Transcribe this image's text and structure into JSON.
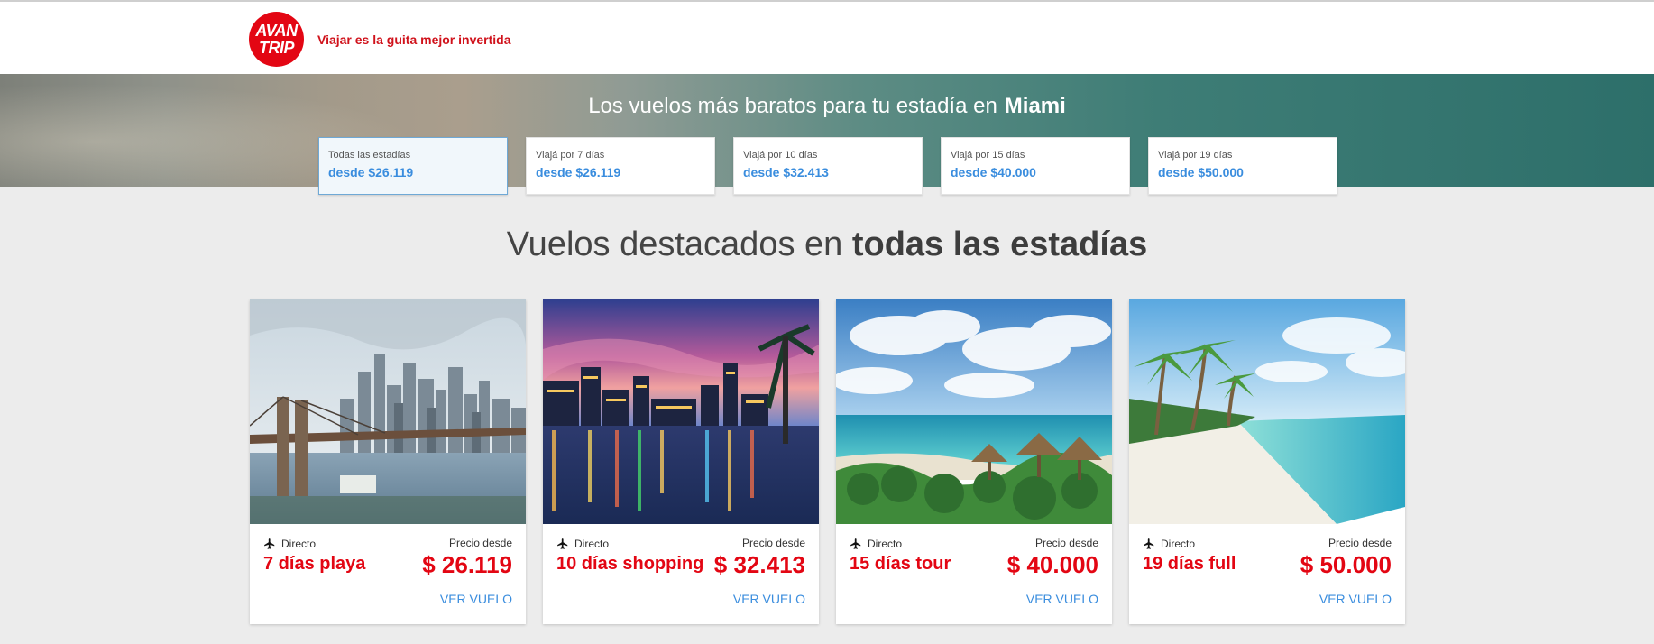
{
  "header": {
    "logo_line1": "AVAN",
    "logo_line2": "TRIP",
    "tagline": "Viajar es la guita mejor invertida"
  },
  "hero": {
    "title_prefix": "Los vuelos más baratos para tu estadía en",
    "city": "Miami"
  },
  "stays": [
    {
      "label": "Todas las estadías",
      "price": "desde $26.119"
    },
    {
      "label": "Viajá por 7 días",
      "price": "desde $26.119"
    },
    {
      "label": "Viajá por 10 días",
      "price": "desde $32.413"
    },
    {
      "label": "Viajá por 15 días",
      "price": "desde $40.000"
    },
    {
      "label": "Viajá por 19 días",
      "price": "desde $50.000"
    }
  ],
  "section": {
    "title_prefix": "Vuelos destacados en",
    "title_bold": "todas las estadías"
  },
  "cards": [
    {
      "tag": "Directo",
      "name": "7 días playa",
      "price_label": "Precio desde",
      "price": "$ 26.119",
      "link": "VER VUELO"
    },
    {
      "tag": "Directo",
      "name": "10 días shopping",
      "price_label": "Precio desde",
      "price": "$ 32.413",
      "link": "VER VUELO"
    },
    {
      "tag": "Directo",
      "name": "15 días tour",
      "price_label": "Precio desde",
      "price": "$ 40.000",
      "link": "VER VUELO"
    },
    {
      "tag": "Directo",
      "name": "19 días full",
      "price_label": "Precio desde",
      "price": "$ 50.000",
      "link": "VER VUELO"
    }
  ],
  "colors": {
    "brand_red": "#e30613",
    "link_blue": "#3a8dde",
    "hero_teal": "#2d6f6a"
  },
  "icons": {
    "flight": "plane-icon"
  }
}
